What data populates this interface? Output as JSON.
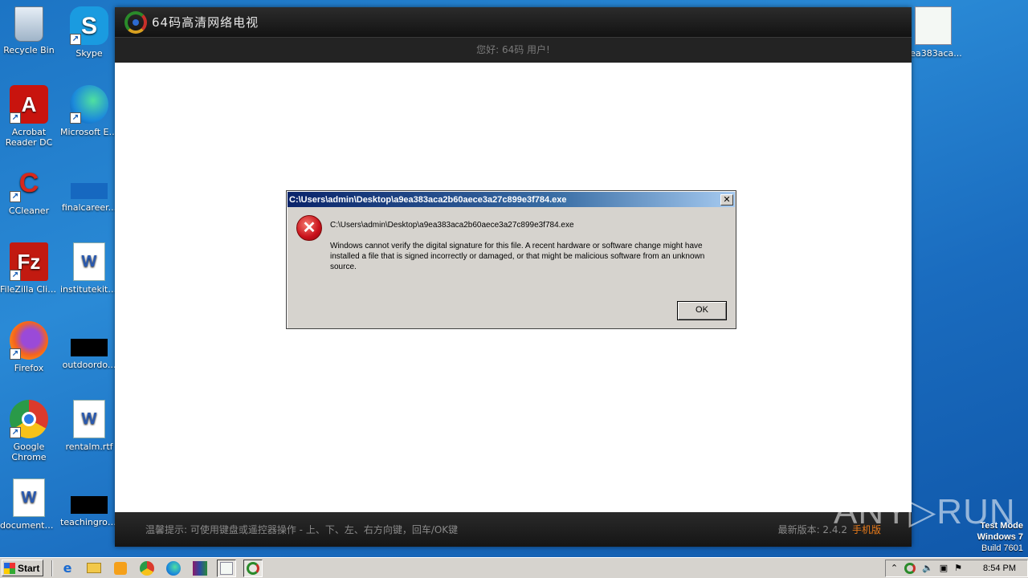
{
  "desktop": {
    "icons": [
      {
        "label": "Recycle Bin"
      },
      {
        "label": "Skype"
      },
      {
        "label": "Acrobat Reader DC"
      },
      {
        "label": "Microsoft Edge"
      },
      {
        "label": "CCleaner"
      },
      {
        "label": "finalcareer..."
      },
      {
        "label": "FileZilla Client"
      },
      {
        "label": "institutekitc..."
      },
      {
        "label": "Firefox"
      },
      {
        "label": "outdoordo..."
      },
      {
        "label": "Google Chrome"
      },
      {
        "label": "rentalm.rtf"
      },
      {
        "label": "documentati..."
      },
      {
        "label": "teachingrou..."
      },
      {
        "label": "9ea383aca..."
      }
    ]
  },
  "app": {
    "title": "64码高清网络电视",
    "greeting": "您好: 64码 用户!",
    "footer_hint": "温馨提示:  可使用键盘或遥控器操作 - 上、下、左、右方向键，回车/OK键",
    "version_label": "最新版本:  2.4.2",
    "mobile_link": "手机版"
  },
  "dialog": {
    "title": "C:\\Users\\admin\\Desktop\\a9ea383aca2b60aece3a27c899e3f784.exe",
    "close_glyph": "✕",
    "error_glyph": "✕",
    "path": "C:\\Users\\admin\\Desktop\\a9ea383aca2b60aece3a27c899e3f784.exe",
    "message": "Windows cannot verify the digital signature for this file. A recent hardware or software change might have installed a file that is signed incorrectly or damaged, or that might be malicious software from an unknown source.",
    "ok_label": "OK"
  },
  "taskbar": {
    "start_label": "Start",
    "clock": "8:54 PM"
  },
  "watermark": "ANY▷RUN",
  "system": {
    "test_mode": "Test Mode",
    "os": "Windows 7",
    "build": "Build 7601"
  }
}
